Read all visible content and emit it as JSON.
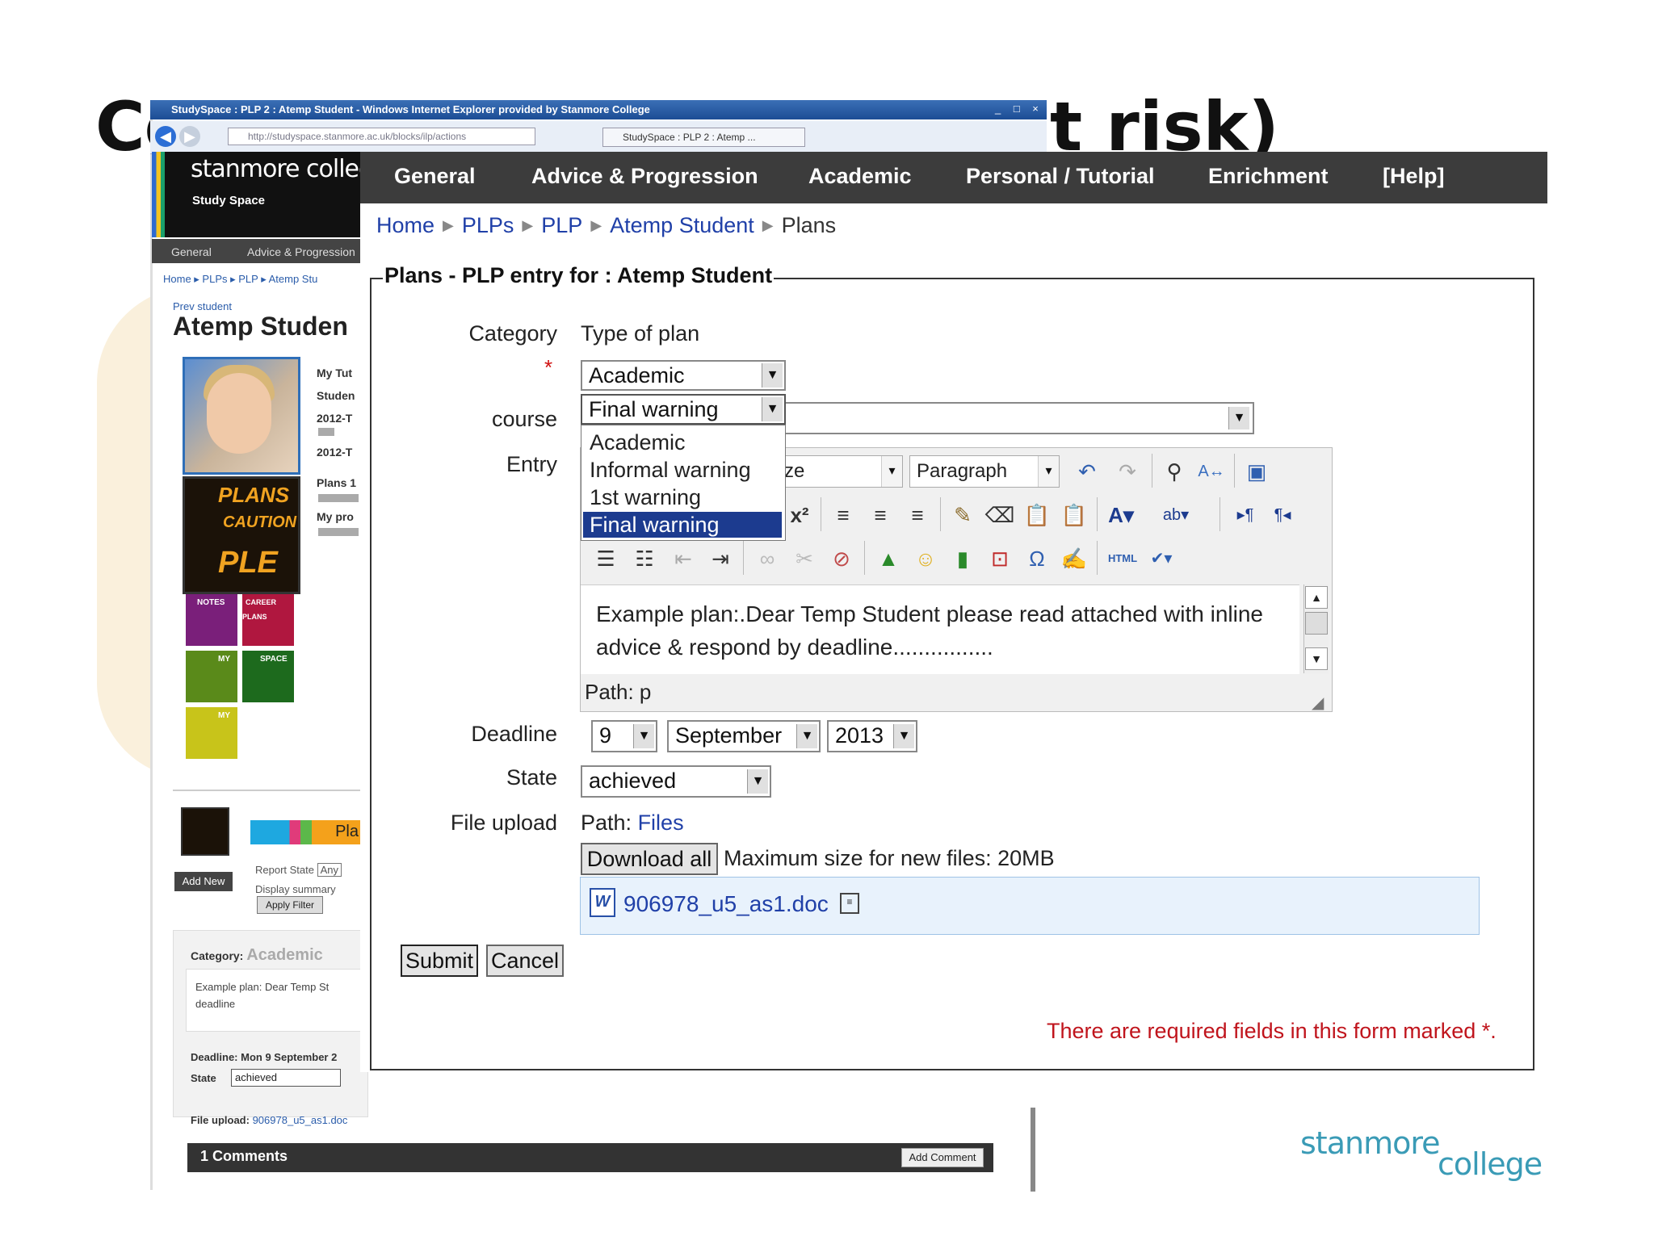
{
  "slide": {
    "title_left": "Co",
    "title_right": "t risk)"
  },
  "browser": {
    "title": "StudySpace : PLP 2 : Atemp Student - Windows Internet Explorer provided by Stanmore College",
    "url": "http://studyspace.stanmore.ac.uk/blocks/ilp/actions",
    "tab": "StudySpace : PLP 2 : Atemp ...",
    "window_buttons": "_ □ ×"
  },
  "background_page": {
    "logo": "stanmore college",
    "study_space": "Study Space",
    "nav": [
      "General",
      "Advice & Progression"
    ],
    "breadcrumb": "Home ▸ PLPs ▸ PLP ▸ Atemp Stu",
    "prev_student": "Prev student",
    "student_name": "Atemp Studen",
    "side_labels": [
      "My Tut",
      "Studen",
      "2012-T",
      "2012-T",
      "Plans 1",
      "My pro"
    ],
    "tile_plans": {
      "l1": "PLANS",
      "l2": "CAUTION",
      "l3": "PLE"
    },
    "tile_labels": [
      "NOTES",
      "CAREER PLANS",
      "MY",
      "SPACE",
      "MY"
    ],
    "color_bar_text": "Pla",
    "add_new": "Add New",
    "report_state": "Report State",
    "report_state_value": "Any",
    "display_summary": "Display summary",
    "apply_filter": "Apply Filter",
    "category_label": "Category:",
    "category_value": "Academic",
    "example": "Example plan: Dear Temp St deadline",
    "deadline": "Deadline: Mon 9 September 2",
    "state_label": "State",
    "state_value": "achieved",
    "file_upload_label": "File upload:",
    "file_upload_value": "906978_u5_as1.doc",
    "comments": "1 Comments",
    "add_comment": "Add Comment"
  },
  "nav": {
    "items": [
      "General",
      "Advice & Progression",
      "Academic",
      "Personal / Tutorial",
      "Enrichment",
      "[Help]"
    ]
  },
  "breadcrumb": {
    "items": [
      "Home",
      "PLPs",
      "PLP",
      "Atemp Student"
    ],
    "current": "Plans",
    "separator": "▶"
  },
  "form": {
    "legend": "Plans - PLP entry for : Atemp Student",
    "category_label": "Category",
    "type_of_plan": "Type of plan",
    "required_star": "*",
    "category_select": "Academic",
    "course_label": "course",
    "plan_type_select": "Final warning",
    "dropdown_options": [
      "Academic",
      "Informal warning",
      "1st warning",
      "Final warning"
    ],
    "entry_label": "Entry",
    "editor": {
      "font_size": "Font size",
      "format": "Paragraph",
      "content": "Example plan:.Dear Temp Student please read attached with inline advice & respond by deadline................",
      "path": "Path: p"
    },
    "deadline_label": "Deadline",
    "deadline_day": "9",
    "deadline_month": "September",
    "deadline_year": "2013",
    "state_label": "State",
    "state_value": "achieved",
    "file_upload_label": "File upload",
    "path_label": "Path:",
    "path_link": "Files",
    "download_all": "Download all",
    "max_size": "Maximum size for new files: 20MB",
    "file_name": "906978_u5_as1.doc",
    "submit": "Submit",
    "cancel": "Cancel",
    "required_note": "There are required fields in this form marked *."
  },
  "footer": {
    "logo_top": "stanmore",
    "logo_bottom": "college"
  },
  "colors": {
    "nav_bg": "#3c3c3c",
    "link": "#2040a8",
    "required": "#c0141c",
    "dropdown_highlight": "#1c3b8f",
    "logo": "#3a9bb6"
  }
}
